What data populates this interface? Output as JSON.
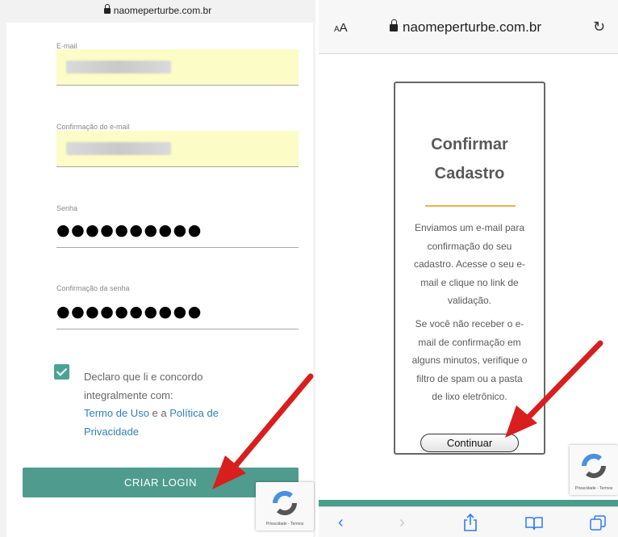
{
  "left": {
    "url": "naomeperturbe.com.br",
    "fields": {
      "email_label": "E-mail",
      "email_confirm_label": "Confirmação do e-mail",
      "password_label": "Senha",
      "password_value": "●●●●●●●●●●",
      "password_confirm_label": "Confirmação da senha",
      "password_confirm_value": "●●●●●●●●●●"
    },
    "terms": {
      "checked": true,
      "text_line1": "Declaro que li e concordo",
      "text_line2": "integralmente com:",
      "terms_link": "Termo de Uso",
      "connector": " e a ",
      "privacy_link_1": "Política de",
      "privacy_link_2": "Privacidade"
    },
    "create_button": "CRIAR LOGIN",
    "recaptcha_label": "Privacidade - Termos"
  },
  "right": {
    "text_size_button": "AA",
    "url": "naomeperturbe.com.br",
    "reload_icon": "reload-icon",
    "card": {
      "title_line1": "Confirmar",
      "title_line2": "Cadastro",
      "p1": [
        "Enviamos um e-mail para",
        "confirmação do seu",
        "cadastro. Acesse o seu e-",
        "mail e clique no link de",
        "validação."
      ],
      "p2": [
        "Se você não receber o e-",
        "mail de confirmação em",
        "alguns minutos, verifique o",
        "filtro de spam ou a pasta",
        "de lixo eletrônico."
      ],
      "continue_button": "Continuar"
    },
    "recaptcha_label": "Privacidade - Termos",
    "toolbar": {
      "back_icon": "‹",
      "forward_icon": "›",
      "share_icon": "share-icon",
      "bookmarks_icon": "book-icon",
      "tabs_icon": "tabs-icon"
    }
  },
  "colors": {
    "accent_teal": "#4f9c8e",
    "autofill_yellow": "#fcfcc6",
    "link_blue": "#2f80b8",
    "rule_gold": "#e6b54a",
    "arrow_red": "#d81e1e",
    "ios_blue": "#2e7cf6"
  }
}
